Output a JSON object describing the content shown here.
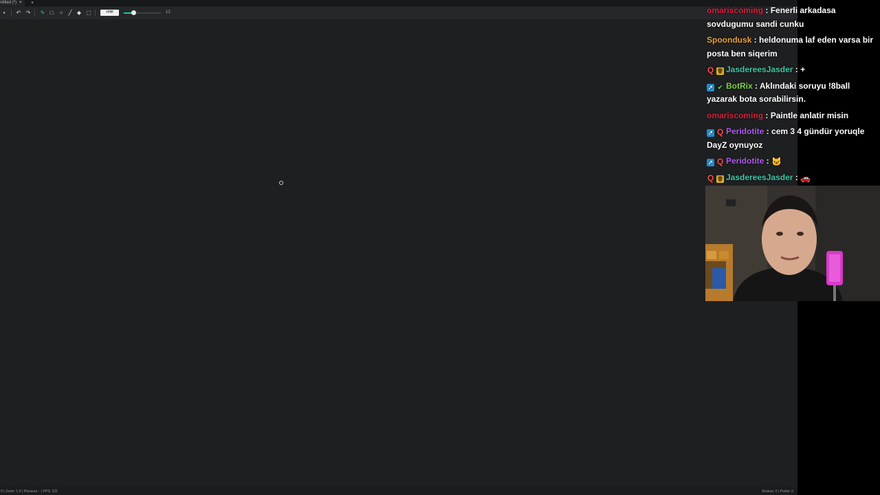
{
  "window": {
    "tab_title": "ntitled (*)",
    "close_glyph": "×",
    "new_tab_glyph": "+"
  },
  "toolbar": {
    "tools": [
      {
        "name": "save-icon",
        "glyph": "▪"
      },
      {
        "name": "undo-icon",
        "glyph": "↶"
      },
      {
        "name": "redo-icon",
        "glyph": "↷"
      },
      {
        "name": "brush-icon",
        "glyph": "✎",
        "active": true
      },
      {
        "name": "rectangle-icon",
        "glyph": "□"
      },
      {
        "name": "circle-icon",
        "glyph": "○"
      },
      {
        "name": "line-icon",
        "glyph": "╱"
      },
      {
        "name": "eraser-icon",
        "glyph": "◆"
      },
      {
        "name": "select-icon",
        "glyph": "⬚"
      }
    ],
    "color_hex": "#ffffff",
    "size_value": "12",
    "size_fraction": 0.25,
    "accent": "#22c3a6"
  },
  "status": {
    "left": "0 | Zoom: 1.0 | Pressure: - | FPS: 131",
    "right": "Strokes: 0 | Points: 0"
  },
  "chat": [
    {
      "name": "omariscoming",
      "color": "#d4213c",
      "badges": [],
      "text": "Fenerli arkadasa sovdugumu sandi cunku",
      "lines": 2
    },
    {
      "name": "Spoondusk",
      "color": "#e8a13a",
      "badges": [],
      "text": "heldonuma laf eden varsa bir posta ben siqerim",
      "lines": 2
    },
    {
      "name": "JasdereesJasder",
      "color": "#3ec9a7",
      "badges": [
        "q",
        "crown"
      ],
      "text": "+",
      "lines": 1
    },
    {
      "name": "BotRix",
      "color": "#7cd14a",
      "badges": [
        "arrow",
        "check"
      ],
      "text": "Aklındaki soruyu !8ball yazarak bota sorabilirsin.",
      "lines": 2
    },
    {
      "name": "omariscoming",
      "color": "#d4213c",
      "badges": [],
      "text": "Paintle anlatir misin",
      "lines": 1
    },
    {
      "name": "Peridotite",
      "color": "#b05cf0",
      "badges": [
        "arrow",
        "q"
      ],
      "text": "cem 3 4 gündür yoruqle DayZ oynuyoz",
      "lines": 2
    },
    {
      "name": "Peridotite",
      "color": "#b05cf0",
      "badges": [
        "arrow",
        "q"
      ],
      "emote": "cat-emote",
      "text": "",
      "lines": 1
    },
    {
      "name": "JasdereesJasder",
      "color": "#3ec9a7",
      "badges": [
        "q",
        "crown"
      ],
      "emote": "cat-car-emote",
      "text": "",
      "lines": 1
    }
  ]
}
